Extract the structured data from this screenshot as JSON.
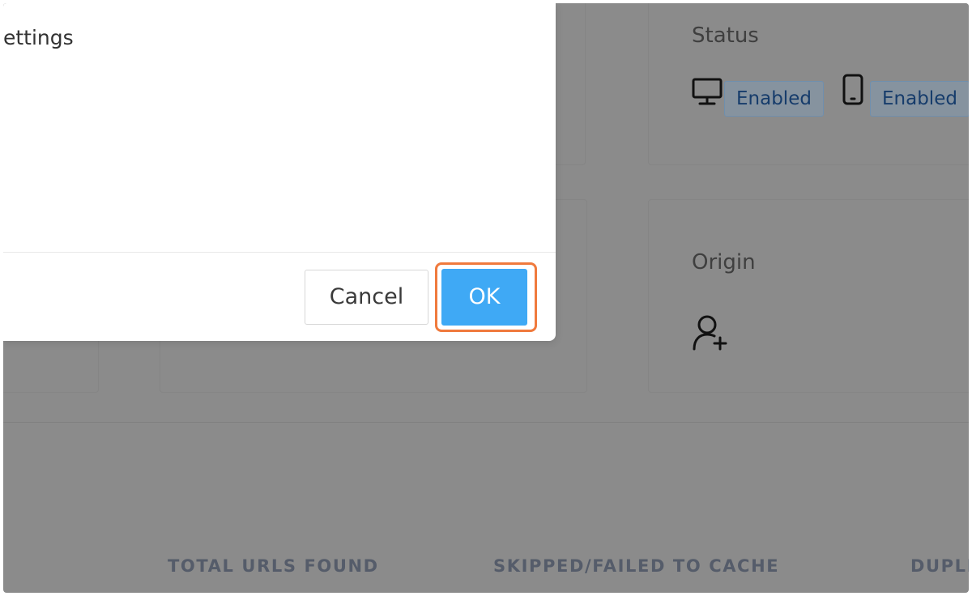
{
  "dialog": {
    "title": "ettings",
    "cancel_label": "Cancel",
    "ok_label": "OK"
  },
  "status_card": {
    "title": "Status",
    "desktop_badge": "Enabled",
    "mobile_badge": "Enabled"
  },
  "origin_card": {
    "title": "Origin",
    "icon": "user-plus-icon"
  },
  "stats": {
    "total_urls_label": "TOTAL URLS FOUND",
    "skipped_label": "SKIPPED/FAILED TO CACHE",
    "duplicates_label": "DUPLI"
  },
  "colors": {
    "overlay": "#8b8b8b",
    "ok_button": "#3fa9f5",
    "highlight": "#f07a3d",
    "badge_text": "#163c6b"
  }
}
